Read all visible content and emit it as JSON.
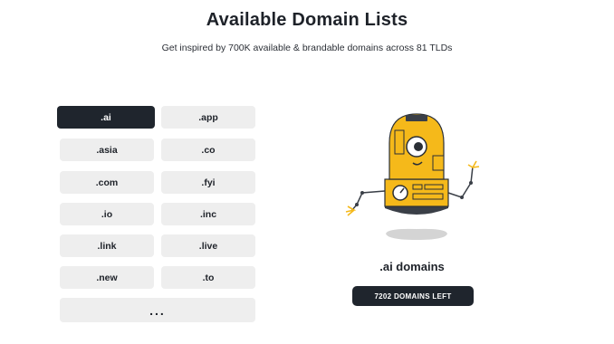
{
  "header": {
    "title": "Available Domain Lists",
    "subtitle": "Get inspired by 700K available & brandable domains across 81 TLDs"
  },
  "tlds": [
    {
      "label": ".ai",
      "active": true
    },
    {
      "label": ".app",
      "active": false
    },
    {
      "label": ".asia",
      "active": false
    },
    {
      "label": ".co",
      "active": false
    },
    {
      "label": ".com",
      "active": false
    },
    {
      "label": ".fyi",
      "active": false
    },
    {
      "label": ".io",
      "active": false
    },
    {
      "label": ".inc",
      "active": false
    },
    {
      "label": ".link",
      "active": false
    },
    {
      "label": ".live",
      "active": false
    },
    {
      "label": ".new",
      "active": false
    },
    {
      "label": ".to",
      "active": false
    }
  ],
  "more_label": "...",
  "selected": {
    "domain_label": ".ai domains",
    "domains_left": "7202 DOMAINS LEFT"
  },
  "colors": {
    "accent_dark": "#1f252d",
    "button_bg": "#eeeeee",
    "robot_yellow": "#f5b91a",
    "robot_shadow": "#d4d4d4"
  },
  "icons": {
    "robot": "robot-mascot-illustration"
  }
}
